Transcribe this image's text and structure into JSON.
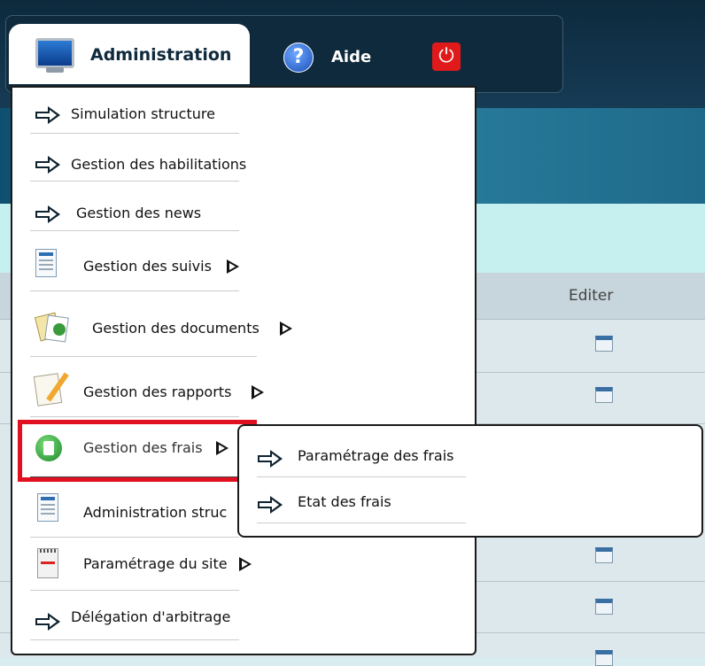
{
  "nav": {
    "admin_label": "Administration",
    "help_label": "Aide"
  },
  "table": {
    "header_edit": "Editer"
  },
  "menu": {
    "items": [
      {
        "label": "Simulation structure",
        "icon": "arrow-right-icon",
        "submenu": false
      },
      {
        "label": "Gestion des habilitations",
        "icon": "arrow-right-icon",
        "submenu": false
      },
      {
        "label": "Gestion des news",
        "icon": "arrow-right-icon",
        "submenu": false
      },
      {
        "label": "Gestion des suivis",
        "icon": "document-icon",
        "submenu": true
      },
      {
        "label": "Gestion des documents",
        "icon": "documents-icon",
        "submenu": true
      },
      {
        "label": "Gestion des rapports",
        "icon": "notepad-icon",
        "submenu": true
      },
      {
        "label": "Gestion des frais",
        "icon": "calculator-icon",
        "submenu": true
      },
      {
        "label": "Administration struc",
        "icon": "document-icon",
        "submenu": true
      },
      {
        "label": "Paramétrage du site",
        "icon": "settings-page-icon",
        "submenu": true
      },
      {
        "label": "Délégation d'arbitrage",
        "icon": "arrow-right-icon",
        "submenu": false
      }
    ]
  },
  "submenu": {
    "items": [
      {
        "label": "Paramétrage des frais"
      },
      {
        "label": "Etat des frais"
      }
    ]
  },
  "colors": {
    "highlight": "#e01020",
    "topbar": "#0d2a3d"
  }
}
